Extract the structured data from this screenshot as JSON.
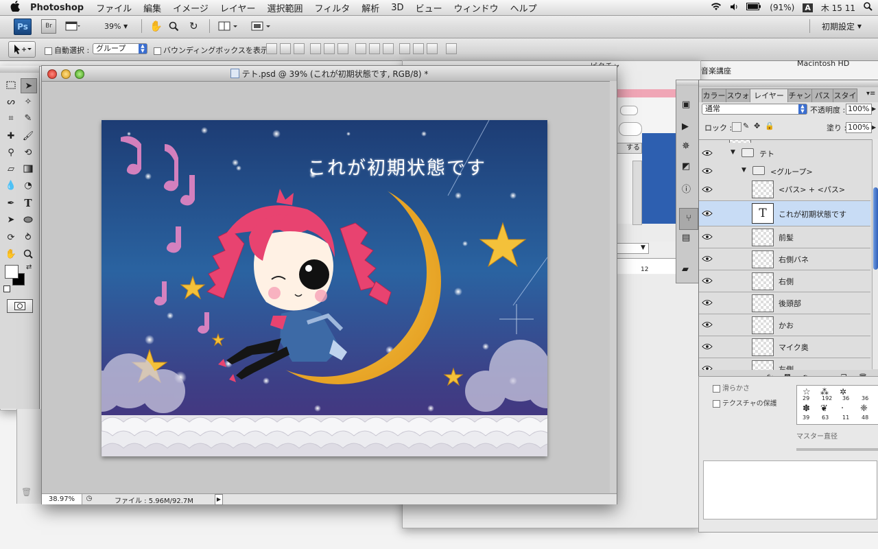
{
  "menubar": {
    "apple": "",
    "app_name": "Photoshop",
    "items": [
      "ファイル",
      "編集",
      "イメージ",
      "レイヤー",
      "選択範囲",
      "フィルタ",
      "解析",
      "3D",
      "ビュー",
      "ウィンドウ",
      "ヘルプ"
    ],
    "battery": "(91%)",
    "input_method": "A",
    "clock": "木 15 11"
  },
  "appbar": {
    "ps_label": "Ps",
    "br_label": "Br",
    "zoom": "39%",
    "workspace": "初期設定"
  },
  "options": {
    "auto_select_label": "自動選択 :",
    "auto_select_value": "グループ",
    "bbox_label": "バウンディングボックスを表示"
  },
  "background_windows": {
    "label1": "ピクチャ",
    "label2": "音楽講座",
    "label3": "Macintosh HD",
    "button_text": "する",
    "ruler_number": "12",
    "checkbox1": "滑らかさ",
    "checkbox2": "テクスチャの保護",
    "master_label": "マスター直径",
    "brush_sizes": [
      "29",
      "192",
      "36",
      "36",
      "39",
      "63",
      "11",
      "48"
    ]
  },
  "document": {
    "title": "テト.psd @ 39% (これが初期状態です, RGB/8) *",
    "zoom_status": "38.97%",
    "file_info": "ファイル : 5.96M/92.7M",
    "canvas_text": "これが初期状態です"
  },
  "layers_panel": {
    "tabs": [
      "カラー",
      "スウォ",
      "レイヤー",
      "チャン",
      "パス",
      "スタイ"
    ],
    "blend_mode": "通常",
    "opacity_label": "不透明度 :",
    "opacity_value": "100%",
    "lock_label": "ロック :",
    "fill_label": "塗り :",
    "fill_value": "100%",
    "text_thumb_glyph": "T",
    "layers": [
      {
        "name": "テト",
        "kind": "group"
      },
      {
        "name": "<グループ>",
        "kind": "group"
      },
      {
        "name": "<パス> + <パス>",
        "kind": "layer"
      },
      {
        "name": "これが初期状態です",
        "kind": "text",
        "selected": true
      },
      {
        "name": "前髪",
        "kind": "layer"
      },
      {
        "name": "右側バネ",
        "kind": "layer"
      },
      {
        "name": "右側",
        "kind": "layer"
      },
      {
        "name": "後頭部",
        "kind": "layer"
      },
      {
        "name": "かお",
        "kind": "layer"
      },
      {
        "name": "マイク奥",
        "kind": "layer"
      },
      {
        "name": "左側",
        "kind": "layer"
      }
    ]
  },
  "colors": {
    "selection": "#c8dcf5",
    "canvas_sky_top": "#1c3f78",
    "moon": "#f1b52c",
    "hair": "#e84370"
  }
}
